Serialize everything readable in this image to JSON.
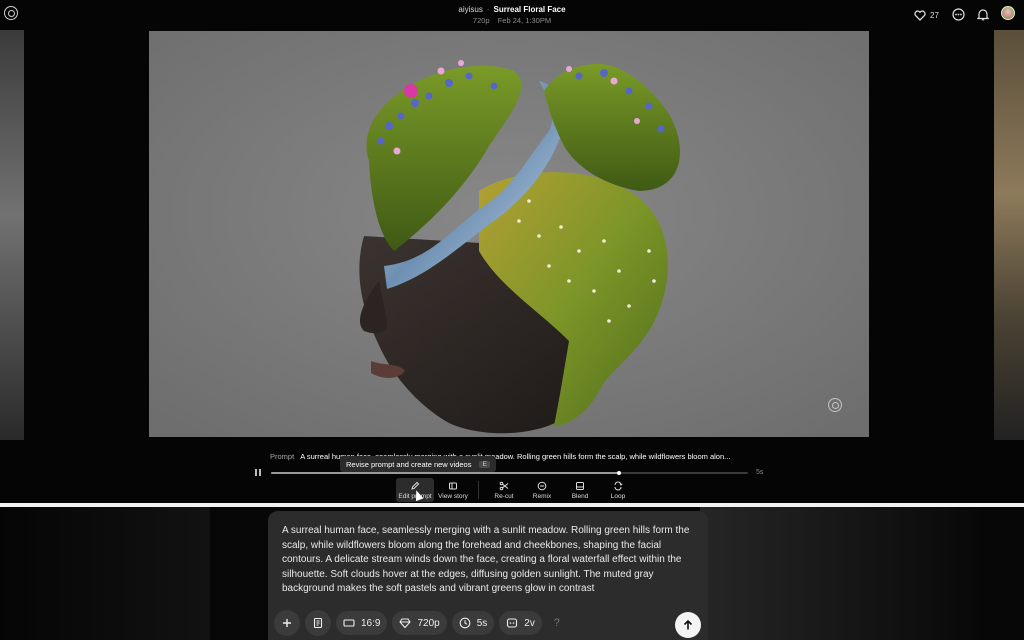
{
  "header": {
    "username": "aiyisus",
    "separator": "·",
    "video_title": "Surreal Floral Face",
    "resolution": "720p",
    "date": "Feb 24, 1:30PM",
    "likes_count": "27",
    "icons": [
      "openai-logo-icon",
      "heart-icon",
      "more-icon",
      "bell-icon",
      "avatar"
    ]
  },
  "player": {
    "prompt_label": "Prompt",
    "prompt_preview": "A surreal human face, seamlessly merging with a sunlit meadow. Rolling green hills form the scalp, while wildflowers bloom alon...",
    "duration": "5s",
    "progress": 0.73,
    "tooltip": {
      "text": "Revise prompt and create new videos",
      "shortcut": "E"
    }
  },
  "toolbar": {
    "edit_prompt": "Edit prompt",
    "view_story": "View story",
    "recut": "Re-cut",
    "remix": "Remix",
    "blend": "Blend",
    "loop": "Loop"
  },
  "composer": {
    "text": "A surreal human face, seamlessly merging with a sunlit meadow. Rolling green hills form the scalp, while wildflowers bloom along the forehead and cheekbones, shaping the facial contours. A delicate stream winds down the face, creating a floral waterfall effect within the silhouette. Soft clouds hover at the edges, diffusing golden sunlight. The muted gray background makes the soft pastels and vibrant greens glow in contrast",
    "aspect_ratio": "16:9",
    "resolution": "720p",
    "duration": "5s",
    "variations": "2v",
    "help": "?"
  },
  "colors": {
    "background": "#000000",
    "composer": "#2c2c2c",
    "chip": "#3b3b3b",
    "send_button": "#f4f4f4"
  }
}
